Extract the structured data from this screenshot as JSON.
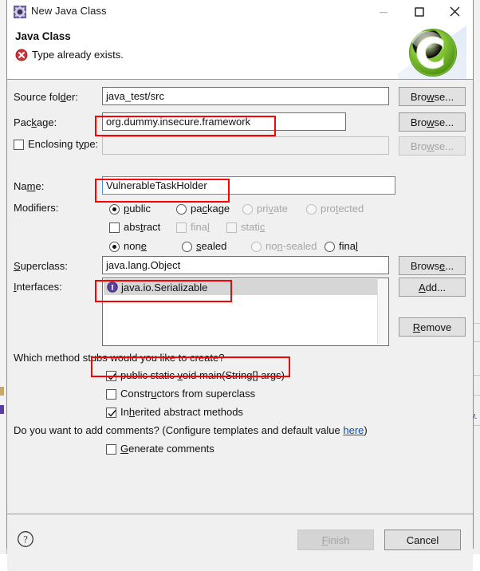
{
  "window": {
    "title": "New Java Class",
    "icon": "java-class-wizard-icon",
    "minimize_label": "—",
    "maximize_label": "□",
    "close_label": "✕"
  },
  "header": {
    "title": "Java Class",
    "message": "Type already exists.",
    "message_icon": "error-icon",
    "logo": "eclipse-c-logo"
  },
  "form": {
    "source_folder": {
      "label": "Source folder:",
      "value": "java_test/src",
      "button": "Browse..."
    },
    "package": {
      "label": "Package:",
      "value": "org.dummy.insecure.framework",
      "button": "Browse..."
    },
    "enclosing_type": {
      "label": "Enclosing type:",
      "value": "",
      "checked": false,
      "button": "Browse...",
      "disabled": true
    },
    "name": {
      "label": "Name:",
      "value": "VulnerableTaskHolder"
    },
    "modifiers": {
      "label": "Modifiers:",
      "access": [
        {
          "label": "public",
          "checked": true,
          "disabled": false
        },
        {
          "label": "package",
          "checked": false,
          "disabled": false
        },
        {
          "label": "private",
          "checked": false,
          "disabled": true
        },
        {
          "label": "protected",
          "checked": false,
          "disabled": true
        }
      ],
      "flags": [
        {
          "label": "abstract",
          "checked": false,
          "disabled": false
        },
        {
          "label": "final",
          "checked": false,
          "disabled": true
        },
        {
          "label": "static",
          "checked": false,
          "disabled": true
        }
      ],
      "sealed": [
        {
          "label": "none",
          "checked": true,
          "disabled": false
        },
        {
          "label": "sealed",
          "checked": false,
          "disabled": false
        },
        {
          "label": "non-sealed",
          "checked": false,
          "disabled": true
        },
        {
          "label": "final",
          "checked": false,
          "disabled": false
        }
      ]
    },
    "superclass": {
      "label": "Superclass:",
      "value": "java.lang.Object",
      "button": "Browse..."
    },
    "interfaces": {
      "label": "Interfaces:",
      "items": [
        {
          "label": "java.io.Serializable",
          "icon": "interface-icon",
          "selected": true
        }
      ],
      "add_button": "Add...",
      "remove_button": "Remove"
    }
  },
  "stubs": {
    "question": "Which method stubs would you like to create?",
    "options": [
      {
        "label": "public static void main(String[] args)",
        "checked": true
      },
      {
        "label": "Constructors from superclass",
        "checked": false
      },
      {
        "label": "Inherited abstract methods",
        "checked": true
      }
    ]
  },
  "comments": {
    "question_prefix": "Do you want to add comments? (Configure templates and default value ",
    "link": "here",
    "question_suffix": ")",
    "option": {
      "label": "Generate comments",
      "checked": false
    }
  },
  "footer": {
    "help_icon": "help-icon",
    "finish_button": "Finish",
    "finish_disabled": true,
    "cancel_button": "Cancel"
  },
  "backdrop": {
    "right_text": "w."
  },
  "colors": {
    "annotation": "#fe0000",
    "error": "#d0323a",
    "link": "#0e4ea8",
    "focus_border": "#4a90d9",
    "logo_green": "#7cc63f",
    "interface_purple": "#5b3f9e",
    "dialog_bg": "#f0f0f0"
  }
}
